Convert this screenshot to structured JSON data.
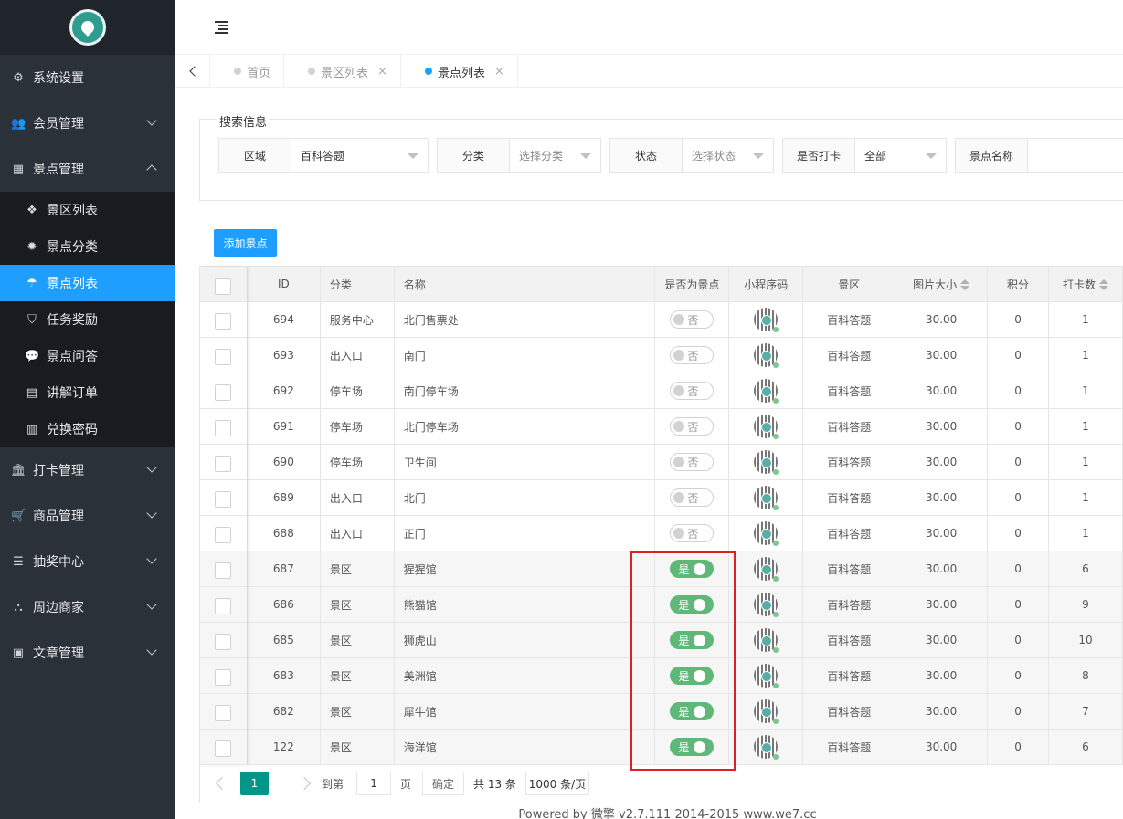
{
  "sidebar": {
    "menu_top": [
      {
        "label": "系统设置",
        "icon": "gears-icon"
      },
      {
        "label": "会员管理",
        "icon": "users-icon"
      },
      {
        "label": "景点管理",
        "icon": "grid-icon"
      }
    ],
    "submenu": [
      {
        "label": "景区列表",
        "icon": "cubes-icon"
      },
      {
        "label": "景点分类",
        "icon": "gear-icon"
      },
      {
        "label": "景点列表",
        "icon": "umbrella-icon"
      },
      {
        "label": "任务奖励",
        "icon": "shield-icon"
      },
      {
        "label": "景点问答",
        "icon": "chat-icon"
      },
      {
        "label": "讲解订单",
        "icon": "file-icon"
      },
      {
        "label": "兑换密码",
        "icon": "barcode-icon"
      }
    ],
    "menu_bottom": [
      {
        "label": "打卡管理",
        "icon": "bank-icon"
      },
      {
        "label": "商品管理",
        "icon": "cart-icon"
      },
      {
        "label": "抽奖中心",
        "icon": "database-icon"
      },
      {
        "label": "周边商家",
        "icon": "sitemap-icon"
      },
      {
        "label": "文章管理",
        "icon": "newspaper-icon"
      }
    ]
  },
  "tabs": [
    {
      "label": "首页"
    },
    {
      "label": "景区列表",
      "close": "×"
    },
    {
      "label": "景点列表",
      "close": "×"
    }
  ],
  "search": {
    "legend": "搜索信息",
    "fields": [
      {
        "label": "区域",
        "value": "百科答题"
      },
      {
        "label": "分类",
        "placeholder": "选择分类"
      },
      {
        "label": "状态",
        "placeholder": "选择状态"
      },
      {
        "label": "是否打卡",
        "value": "全部"
      },
      {
        "label": "景点名称",
        "value": ""
      }
    ]
  },
  "toolbar": {
    "add_label": "添加景点"
  },
  "table": {
    "headers": [
      "ID",
      "分类",
      "名称",
      "是否为景点",
      "小程序码",
      "景区",
      "图片大小",
      "积分",
      "打卡数"
    ],
    "rows": [
      {
        "id": "694",
        "category": "服务中心",
        "name": "北门售票处",
        "is_spot": "否",
        "area": "百科答题",
        "size": "30.00",
        "points": "0",
        "checkins": "1"
      },
      {
        "id": "693",
        "category": "出入口",
        "name": "南门",
        "is_spot": "否",
        "area": "百科答题",
        "size": "30.00",
        "points": "0",
        "checkins": "1"
      },
      {
        "id": "692",
        "category": "停车场",
        "name": "南门停车场",
        "is_spot": "否",
        "area": "百科答题",
        "size": "30.00",
        "points": "0",
        "checkins": "1"
      },
      {
        "id": "691",
        "category": "停车场",
        "name": "北门停车场",
        "is_spot": "否",
        "area": "百科答题",
        "size": "30.00",
        "points": "0",
        "checkins": "1"
      },
      {
        "id": "690",
        "category": "停车场",
        "name": "卫生间",
        "is_spot": "否",
        "area": "百科答题",
        "size": "30.00",
        "points": "0",
        "checkins": "1"
      },
      {
        "id": "689",
        "category": "出入口",
        "name": "北门",
        "is_spot": "否",
        "area": "百科答题",
        "size": "30.00",
        "points": "0",
        "checkins": "1"
      },
      {
        "id": "688",
        "category": "出入口",
        "name": "正门",
        "is_spot": "否",
        "area": "百科答题",
        "size": "30.00",
        "points": "0",
        "checkins": "1"
      },
      {
        "id": "687",
        "category": "景区",
        "name": "猩猩馆",
        "is_spot": "是",
        "area": "百科答题",
        "size": "30.00",
        "points": "0",
        "checkins": "6"
      },
      {
        "id": "686",
        "category": "景区",
        "name": "熊猫馆",
        "is_spot": "是",
        "area": "百科答题",
        "size": "30.00",
        "points": "0",
        "checkins": "9"
      },
      {
        "id": "685",
        "category": "景区",
        "name": "狮虎山",
        "is_spot": "是",
        "area": "百科答题",
        "size": "30.00",
        "points": "0",
        "checkins": "10"
      },
      {
        "id": "683",
        "category": "景区",
        "name": "美洲馆",
        "is_spot": "是",
        "area": "百科答题",
        "size": "30.00",
        "points": "0",
        "checkins": "8"
      },
      {
        "id": "682",
        "category": "景区",
        "name": "犀牛馆",
        "is_spot": "是",
        "area": "百科答题",
        "size": "30.00",
        "points": "0",
        "checkins": "7"
      },
      {
        "id": "122",
        "category": "景区",
        "name": "海洋馆",
        "is_spot": "是",
        "area": "百科答题",
        "size": "30.00",
        "points": "0",
        "checkins": "6"
      }
    ]
  },
  "pager": {
    "current": "1",
    "goto_prefix": "到第",
    "goto_value": "1",
    "goto_suffix": "页",
    "confirm": "确定",
    "total": "共 13 条",
    "limit": "1000 条/页"
  },
  "footer": {
    "text": "Powered by 微擎 v2.7.111 2014-2015 www.we7.cc"
  },
  "colors": {
    "accent": "#1e9fff",
    "switch_on": "#5fb878",
    "sidebar_bg": "#2b3139",
    "pager_active": "#009688",
    "highlight": "#e02020"
  }
}
